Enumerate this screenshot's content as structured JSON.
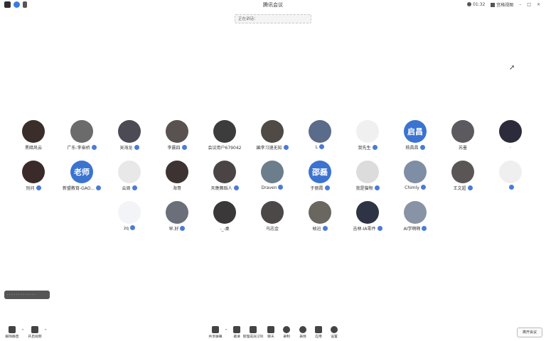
{
  "window": {
    "title": "腾讯会议",
    "time": "01:32",
    "view_label": "宫格视图",
    "window_buttons": [
      "–",
      "□",
      "×"
    ]
  },
  "speaking_banner": "正在讲话：",
  "participants": [
    {
      "name": "黑暗风云",
      "avatar_color": "#3a2e2a",
      "mic": false
    },
    {
      "name": "广东-李奋桥",
      "avatar_color": "#6b6b6b",
      "mic": true
    },
    {
      "name": "吴海龙",
      "avatar_color": "#4b4a55",
      "mic": true
    },
    {
      "name": "李晨四",
      "avatar_color": "#5a5250",
      "mic": true
    },
    {
      "name": "会议用户679042",
      "avatar_color": "#3c3c3c",
      "mic": false
    },
    {
      "name": "編李习速无知",
      "avatar_color": "#4f4a45",
      "mic": true
    },
    {
      "name": "L",
      "avatar_color": "#5b6b8a",
      "mic": true
    },
    {
      "name": "我先生",
      "avatar_color": "#f0f0f0",
      "mic": true
    },
    {
      "name": "杨昌昌",
      "avatar_color": "#3b73d1",
      "avatar_text": "启昌",
      "mic": true
    },
    {
      "name": "苏墨",
      "avatar_color": "#5c5a5e",
      "mic": false
    },
    {
      "name": ".",
      "avatar_color": "#2c2b3c",
      "mic": false
    },
    {
      "name": "别问",
      "avatar_color": "#3a2a2a",
      "mic": true
    },
    {
      "name": "新盟教育-GAO...",
      "avatar_color": "#3b73d1",
      "avatar_text": "老师",
      "mic": true
    },
    {
      "name": "云周",
      "avatar_color": "#e8e8e8",
      "mic": true
    },
    {
      "name": "海哥",
      "avatar_color": "#3d3333",
      "mic": false
    },
    {
      "name": "天晚舞蹈人",
      "avatar_color": "#4a4444",
      "mic": true
    },
    {
      "name": "Draven",
      "avatar_color": "#6c7d8c",
      "mic": true
    },
    {
      "name": "于丽霞",
      "avatar_color": "#3b73d1",
      "avatar_text": "邵磊",
      "mic": true
    },
    {
      "name": "我是猫物",
      "avatar_color": "#dcdcdc",
      "mic": true
    },
    {
      "name": "Chimly",
      "avatar_color": "#7d8ea5",
      "mic": true
    },
    {
      "name": "王文超",
      "avatar_color": "#5a5656",
      "mic": true
    },
    {
      "name": "",
      "avatar_color": "#efefef",
      "mic": true
    },
    {
      "name": "zq",
      "avatar_color": "#f2f4f8",
      "mic": true
    },
    {
      "name": "早.好",
      "avatar_color": "#6a6f7a",
      "mic": true
    },
    {
      "name": "-_-桌",
      "avatar_color": "#3a3838",
      "mic": false
    },
    {
      "name": "乌志金",
      "avatar_color": "#4c4848",
      "mic": false
    },
    {
      "name": "帧迅",
      "avatar_color": "#6a6660",
      "mic": true
    },
    {
      "name": "吉林-IA零件",
      "avatar_color": "#2e3444",
      "mic": true
    },
    {
      "name": "AI学啊啊",
      "avatar_color": "#8893a5",
      "mic": true
    }
  ],
  "chat_pill": "· · · · · · · · · · · · ·",
  "toolbar": {
    "left": [
      {
        "label": "解除静音",
        "icon": "mic-muted-icon"
      },
      {
        "label": "开启视频",
        "icon": "camera-off-icon"
      }
    ],
    "center": [
      {
        "label": "共享屏幕",
        "icon": "share-screen-icon"
      },
      {
        "label": "邀请",
        "icon": "invite-icon"
      },
      {
        "label": "管理成员(29)",
        "icon": "members-icon"
      },
      {
        "label": "聊天",
        "icon": "chat-icon"
      },
      {
        "label": "录制",
        "icon": "record-icon"
      },
      {
        "label": "表情",
        "icon": "emoji-icon"
      },
      {
        "label": "应用",
        "icon": "apps-icon"
      },
      {
        "label": "设置",
        "icon": "settings-icon"
      }
    ],
    "end_meeting": "离开会议"
  }
}
